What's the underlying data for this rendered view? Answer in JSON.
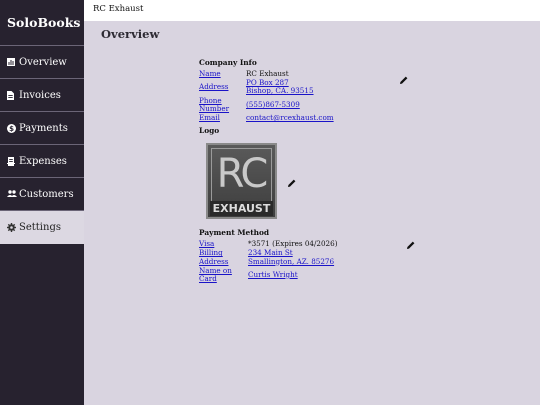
{
  "app": {
    "name": "SoloBooks"
  },
  "topbar": {
    "company": "RC Exhaust"
  },
  "sidebar": {
    "items": [
      {
        "label": "Overview",
        "icon": "chart-icon"
      },
      {
        "label": "Invoices",
        "icon": "document-icon"
      },
      {
        "label": "Payments",
        "icon": "dollar-icon"
      },
      {
        "label": "Expenses",
        "icon": "receipt-icon"
      },
      {
        "label": "Customers",
        "icon": "people-icon"
      },
      {
        "label": "Settings",
        "icon": "gear-icon",
        "active": true
      }
    ]
  },
  "main": {
    "title": "Overview",
    "company_info": {
      "heading": "Company Info",
      "name_label": "Name",
      "name_value": "RC Exhaust",
      "address_label": "Address",
      "address_line1": "PO Box 287",
      "address_line2": "Bishop, CA. 93515",
      "phone_label": "Phone Number",
      "phone_value": "(555)867-5309",
      "email_label": "Email",
      "email_value": "contact@rcexhaust.com"
    },
    "logo": {
      "heading": "Logo",
      "text_top": "RC",
      "text_bottom": "EXHAUST"
    },
    "payment_method": {
      "heading": "Payment Method",
      "card_label": "Visa",
      "card_value": "*3571 (Expires 04/2026)",
      "billing_label": "Billing Address",
      "billing_line1": "234 Main St",
      "billing_line2": "Smallington, AZ. 85276",
      "name_label": "Name on Card",
      "name_value": "Curtis Wright"
    }
  }
}
